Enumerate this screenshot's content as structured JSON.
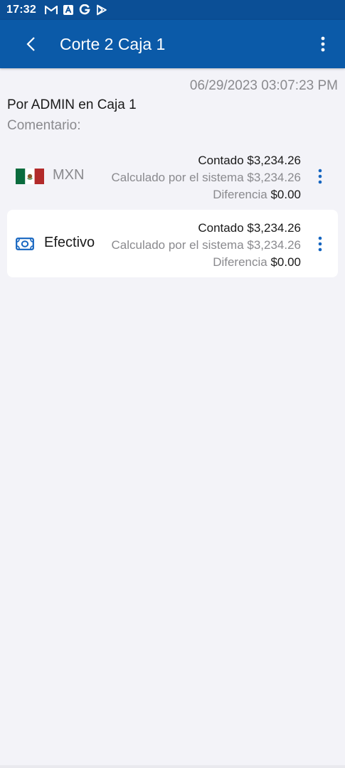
{
  "status_bar": {
    "time": "17:32",
    "icons": [
      "gmail-icon",
      "app-a-icon",
      "google-icon",
      "play-store-icon"
    ]
  },
  "app_bar": {
    "title": "Corte 2 Caja 1",
    "back_icon": "chevron-left-icon",
    "menu_icon": "more-vert-icon"
  },
  "cut": {
    "timestamp": "06/29/2023 03:07:23 PM",
    "by_line": "Por ADMIN en Caja 1",
    "comment_label": "Comentario:"
  },
  "rows": [
    {
      "name": "MXN",
      "icon": "mexico-flag-icon",
      "counted": "Contado $3,234.26",
      "calculated": "Calculado por el sistema $3,234.26",
      "difference_label": "Diferencia ",
      "difference_value": "$0.00"
    },
    {
      "name": "Efectivo",
      "icon": "cash-icon",
      "counted": "Contado $3,234.26",
      "calculated": "Calculado por el sistema $3,234.26",
      "difference_label": "Diferencia ",
      "difference_value": "$0.00"
    }
  ],
  "colors": {
    "status_bar": "#0b4f96",
    "app_bar": "#0b5aa8",
    "accent": "#1565c0",
    "background": "#f3f3f8"
  }
}
